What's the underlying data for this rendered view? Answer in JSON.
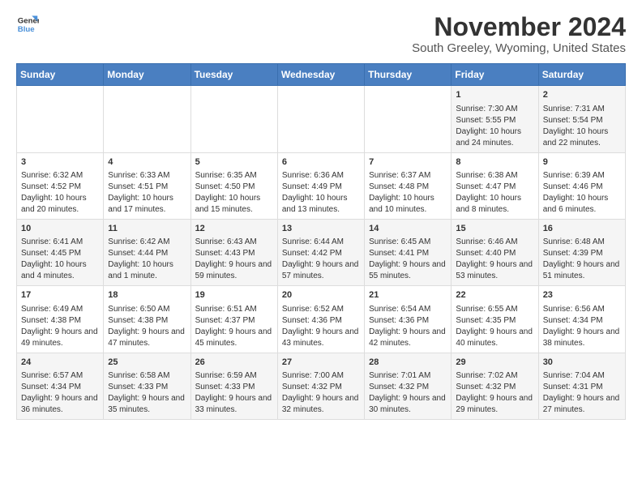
{
  "logo": {
    "line1": "General",
    "line2": "Blue"
  },
  "title": "November 2024",
  "subtitle": "South Greeley, Wyoming, United States",
  "days_of_week": [
    "Sunday",
    "Monday",
    "Tuesday",
    "Wednesday",
    "Thursday",
    "Friday",
    "Saturday"
  ],
  "weeks": [
    [
      {
        "day": "",
        "content": ""
      },
      {
        "day": "",
        "content": ""
      },
      {
        "day": "",
        "content": ""
      },
      {
        "day": "",
        "content": ""
      },
      {
        "day": "",
        "content": ""
      },
      {
        "day": "1",
        "content": "Sunrise: 7:30 AM\nSunset: 5:55 PM\nDaylight: 10 hours and 24 minutes."
      },
      {
        "day": "2",
        "content": "Sunrise: 7:31 AM\nSunset: 5:54 PM\nDaylight: 10 hours and 22 minutes."
      }
    ],
    [
      {
        "day": "3",
        "content": "Sunrise: 6:32 AM\nSunset: 4:52 PM\nDaylight: 10 hours and 20 minutes."
      },
      {
        "day": "4",
        "content": "Sunrise: 6:33 AM\nSunset: 4:51 PM\nDaylight: 10 hours and 17 minutes."
      },
      {
        "day": "5",
        "content": "Sunrise: 6:35 AM\nSunset: 4:50 PM\nDaylight: 10 hours and 15 minutes."
      },
      {
        "day": "6",
        "content": "Sunrise: 6:36 AM\nSunset: 4:49 PM\nDaylight: 10 hours and 13 minutes."
      },
      {
        "day": "7",
        "content": "Sunrise: 6:37 AM\nSunset: 4:48 PM\nDaylight: 10 hours and 10 minutes."
      },
      {
        "day": "8",
        "content": "Sunrise: 6:38 AM\nSunset: 4:47 PM\nDaylight: 10 hours and 8 minutes."
      },
      {
        "day": "9",
        "content": "Sunrise: 6:39 AM\nSunset: 4:46 PM\nDaylight: 10 hours and 6 minutes."
      }
    ],
    [
      {
        "day": "10",
        "content": "Sunrise: 6:41 AM\nSunset: 4:45 PM\nDaylight: 10 hours and 4 minutes."
      },
      {
        "day": "11",
        "content": "Sunrise: 6:42 AM\nSunset: 4:44 PM\nDaylight: 10 hours and 1 minute."
      },
      {
        "day": "12",
        "content": "Sunrise: 6:43 AM\nSunset: 4:43 PM\nDaylight: 9 hours and 59 minutes."
      },
      {
        "day": "13",
        "content": "Sunrise: 6:44 AM\nSunset: 4:42 PM\nDaylight: 9 hours and 57 minutes."
      },
      {
        "day": "14",
        "content": "Sunrise: 6:45 AM\nSunset: 4:41 PM\nDaylight: 9 hours and 55 minutes."
      },
      {
        "day": "15",
        "content": "Sunrise: 6:46 AM\nSunset: 4:40 PM\nDaylight: 9 hours and 53 minutes."
      },
      {
        "day": "16",
        "content": "Sunrise: 6:48 AM\nSunset: 4:39 PM\nDaylight: 9 hours and 51 minutes."
      }
    ],
    [
      {
        "day": "17",
        "content": "Sunrise: 6:49 AM\nSunset: 4:38 PM\nDaylight: 9 hours and 49 minutes."
      },
      {
        "day": "18",
        "content": "Sunrise: 6:50 AM\nSunset: 4:38 PM\nDaylight: 9 hours and 47 minutes."
      },
      {
        "day": "19",
        "content": "Sunrise: 6:51 AM\nSunset: 4:37 PM\nDaylight: 9 hours and 45 minutes."
      },
      {
        "day": "20",
        "content": "Sunrise: 6:52 AM\nSunset: 4:36 PM\nDaylight: 9 hours and 43 minutes."
      },
      {
        "day": "21",
        "content": "Sunrise: 6:54 AM\nSunset: 4:36 PM\nDaylight: 9 hours and 42 minutes."
      },
      {
        "day": "22",
        "content": "Sunrise: 6:55 AM\nSunset: 4:35 PM\nDaylight: 9 hours and 40 minutes."
      },
      {
        "day": "23",
        "content": "Sunrise: 6:56 AM\nSunset: 4:34 PM\nDaylight: 9 hours and 38 minutes."
      }
    ],
    [
      {
        "day": "24",
        "content": "Sunrise: 6:57 AM\nSunset: 4:34 PM\nDaylight: 9 hours and 36 minutes."
      },
      {
        "day": "25",
        "content": "Sunrise: 6:58 AM\nSunset: 4:33 PM\nDaylight: 9 hours and 35 minutes."
      },
      {
        "day": "26",
        "content": "Sunrise: 6:59 AM\nSunset: 4:33 PM\nDaylight: 9 hours and 33 minutes."
      },
      {
        "day": "27",
        "content": "Sunrise: 7:00 AM\nSunset: 4:32 PM\nDaylight: 9 hours and 32 minutes."
      },
      {
        "day": "28",
        "content": "Sunrise: 7:01 AM\nSunset: 4:32 PM\nDaylight: 9 hours and 30 minutes."
      },
      {
        "day": "29",
        "content": "Sunrise: 7:02 AM\nSunset: 4:32 PM\nDaylight: 9 hours and 29 minutes."
      },
      {
        "day": "30",
        "content": "Sunrise: 7:04 AM\nSunset: 4:31 PM\nDaylight: 9 hours and 27 minutes."
      }
    ]
  ]
}
